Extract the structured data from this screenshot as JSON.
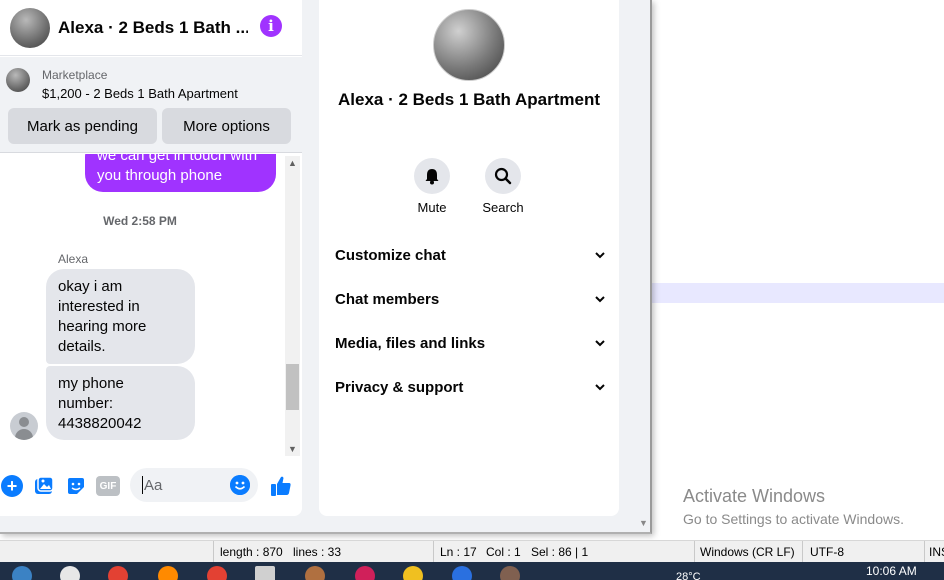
{
  "chat": {
    "title": "Alexa · 2 Beds 1 Bath ...",
    "marketplace_label": "Marketplace",
    "listing": "$1,200 - 2 Beds 1 Bath Apartment",
    "mark_pending": "Mark as pending",
    "more_options": "More options",
    "outgoing_message": "we can get in touch with you through phone",
    "timestamp": "Wed 2:58 PM",
    "sender": "Alexa",
    "incoming": [
      "okay i am interested in hearing more details.",
      "my phone number: 4438820042"
    ],
    "input_placeholder": "Aa",
    "gif_label": "GIF"
  },
  "info": {
    "name": "Alexa · 2 Beds 1 Bath Apartment",
    "actions": {
      "mute": "Mute",
      "search": "Search"
    },
    "sections": {
      "customize": "Customize chat",
      "members": "Chat members",
      "media": "Media, files and links",
      "privacy": "Privacy & support"
    }
  },
  "editor": {
    "activate_title": "Activate Windows",
    "activate_sub": "Go to Settings to activate Windows."
  },
  "statusbar": {
    "length": "length : 870",
    "lines": "lines : 33",
    "ln": "Ln : 17",
    "col": "Col : 1",
    "sel": "Sel : 86 | 1",
    "eol": "Windows (CR LF)",
    "encoding": "UTF-8",
    "ins": "INS"
  },
  "taskbar": {
    "temperature": "28°C",
    "clock": "10:06 AM"
  },
  "colors": {
    "accent": "#a033ff",
    "messenger_blue": "#0a7cff"
  }
}
